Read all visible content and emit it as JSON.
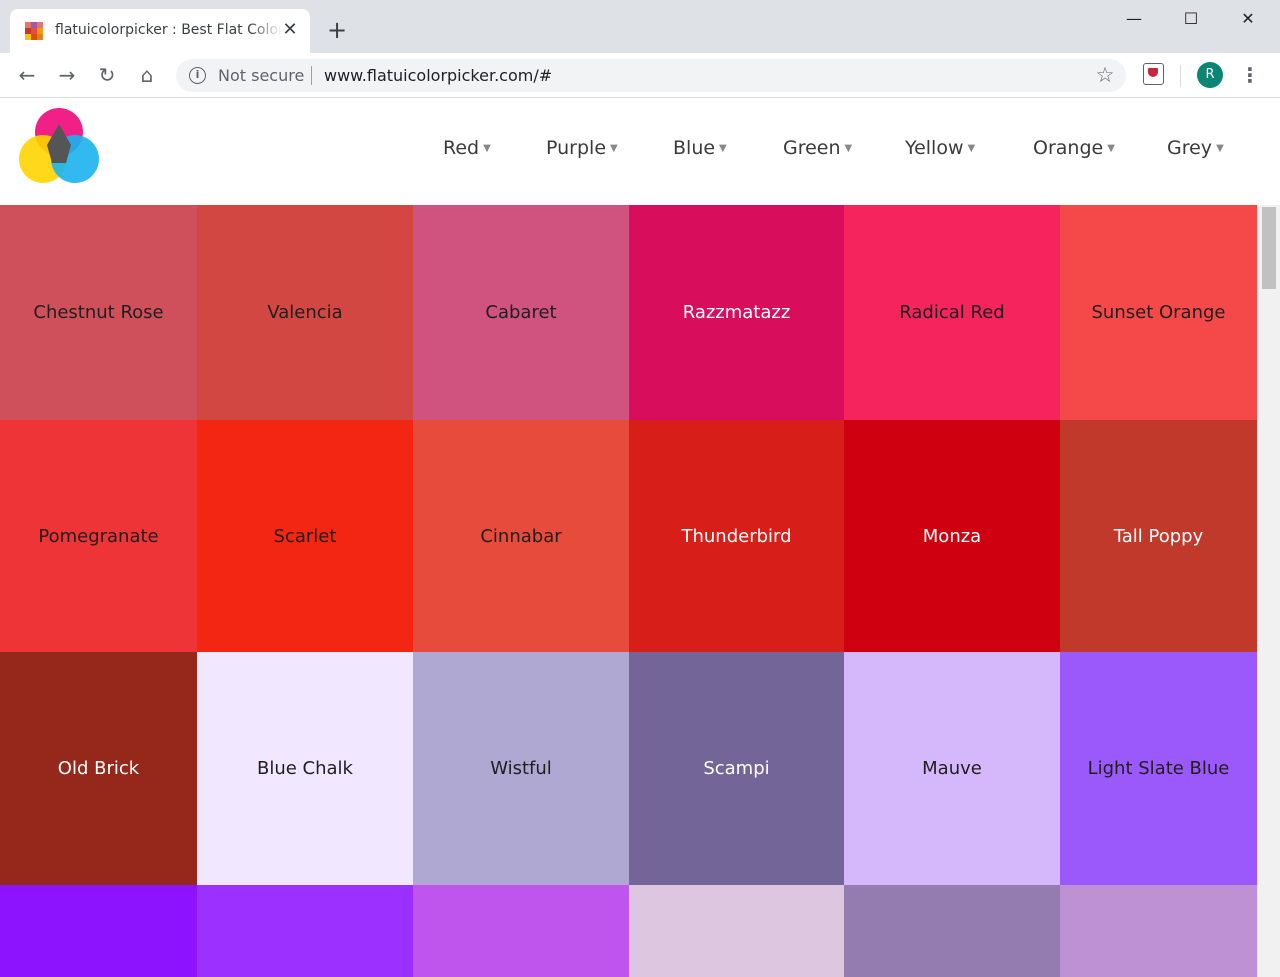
{
  "browser": {
    "tab_title": "flatuicolorpicker : Best Flat Colors",
    "tab_close": "✕",
    "new_tab": "+",
    "window_controls": {
      "minimize": "—",
      "maximize": "☐",
      "close": "✕"
    },
    "nav": {
      "back": "←",
      "forward": "→",
      "reload": "↻",
      "home": "⌂"
    },
    "security_label": "Not secure",
    "url": "www.flatuicolorpicker.com/#",
    "bookmark_icon": "☆",
    "profile_initial": "R",
    "menu_icon": "⋮"
  },
  "site": {
    "nav_items": [
      {
        "label": "Red",
        "caret": "▼"
      },
      {
        "label": "Purple",
        "caret": "▼"
      },
      {
        "label": "Blue",
        "caret": "▼"
      },
      {
        "label": "Green",
        "caret": "▼"
      },
      {
        "label": "Yellow",
        "caret": "▼"
      },
      {
        "label": "Orange",
        "caret": "▼"
      },
      {
        "label": "Grey",
        "caret": "▼"
      }
    ]
  },
  "swatches": [
    [
      {
        "name": "Chestnut Rose",
        "color": "#cf4f5a",
        "text_color": "#1f1f1f"
      },
      {
        "name": "Valencia",
        "color": "#d24741",
        "text_color": "#1f1f1f"
      },
      {
        "name": "Cabaret",
        "color": "#cf537e",
        "text_color": "#1f1f1f"
      },
      {
        "name": "Razzmatazz",
        "color": "#d80d5c",
        "text_color": "#ffffff"
      },
      {
        "name": "Radical Red",
        "color": "#f5245c",
        "text_color": "#1f1f1f"
      },
      {
        "name": "Sunset Orange",
        "color": "#f54949",
        "text_color": "#1f1f1f"
      }
    ],
    [
      {
        "name": "Pomegranate",
        "color": "#ef3438",
        "text_color": "#1f1f1f"
      },
      {
        "name": "Scarlet",
        "color": "#f22613",
        "text_color": "#1f1f1f"
      },
      {
        "name": "Cinnabar",
        "color": "#e74b3c",
        "text_color": "#1f1f1f"
      },
      {
        "name": "Thunderbird",
        "color": "#d81e18",
        "text_color": "#ffffff"
      },
      {
        "name": "Monza",
        "color": "#cf000f",
        "text_color": "#ffffff"
      },
      {
        "name": "Tall Poppy",
        "color": "#c0392b",
        "text_color": "#ffffff"
      }
    ],
    [
      {
        "name": "Old Brick",
        "color": "#96281b",
        "text_color": "#ffffff"
      },
      {
        "name": "Blue Chalk",
        "color": "#f1e7fe",
        "text_color": "#1f1f1f"
      },
      {
        "name": "Wistful",
        "color": "#aea8d3",
        "text_color": "#1f1f1f"
      },
      {
        "name": "Scampi",
        "color": "#736598",
        "text_color": "#ffffff"
      },
      {
        "name": "Mauve",
        "color": "#d5b8fc",
        "text_color": "#1f1f1f"
      },
      {
        "name": "Light Slate Blue",
        "color": "#9b59fb",
        "text_color": "#1f1f1f"
      }
    ],
    [
      {
        "name": "",
        "color": "#8d12fe",
        "text_color": "#ffffff"
      },
      {
        "name": "",
        "color": "#9b30ff",
        "text_color": "#ffffff"
      },
      {
        "name": "",
        "color": "#bf55ec",
        "text_color": "#1f1f1f"
      },
      {
        "name": "",
        "color": "#dcc6e0",
        "text_color": "#1f1f1f"
      },
      {
        "name": "",
        "color": "#947cb0",
        "text_color": "#ffffff"
      },
      {
        "name": "",
        "color": "#be90d4",
        "text_color": "#1f1f1f"
      }
    ]
  ]
}
